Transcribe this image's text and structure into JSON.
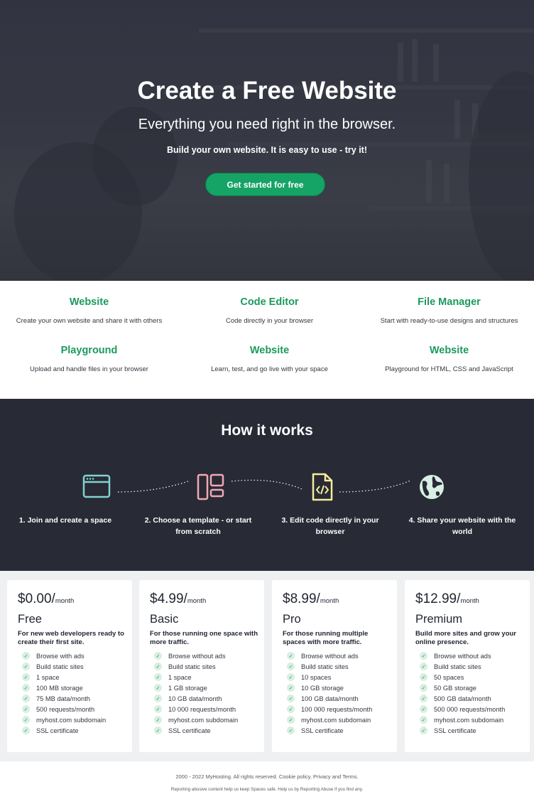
{
  "hero": {
    "title": "Create a Free Website",
    "subtitle": "Everything you need right in the browser.",
    "tagline": "Build your own website. It is easy to use - try it!",
    "cta": "Get started for free"
  },
  "features": [
    {
      "title": "Website",
      "description": "Create your own website and share it with others"
    },
    {
      "title": "Code Editor",
      "description": "Code directly in your browser"
    },
    {
      "title": "File Manager",
      "description": "Start with ready-to-use designs and structures"
    },
    {
      "title": "Playground",
      "description": "Upload and handle files in your browser"
    },
    {
      "title": "Website",
      "description": "Learn, test, and go live with your space"
    },
    {
      "title": "Website",
      "description": "Playground for HTML, CSS and JavaScript"
    }
  ],
  "how_it_works": {
    "title": "How it works",
    "steps": [
      {
        "label": "1. Join and create a space",
        "icon": "browser-window-icon",
        "color": "#7fd3d0"
      },
      {
        "label": "2. Choose a template - or start from scratch",
        "icon": "template-layout-icon",
        "color": "#f2a7b4"
      },
      {
        "label": "3. Edit code directly in your browser",
        "icon": "code-file-icon",
        "color": "#f7ec9a"
      },
      {
        "label": "4. Share your website with the world",
        "icon": "globe-icon",
        "color": "#d9efe6"
      }
    ]
  },
  "pricing": [
    {
      "price": "$0.00/",
      "period": "month",
      "name": "Free",
      "description": "For new web developers ready to create their first site.",
      "features": [
        "Browse with ads",
        "Build static sites",
        "1 space",
        "100 MB storage",
        "75 MB data/month",
        "500 requests/month",
        "myhost.com subdomain",
        "SSL certificate"
      ]
    },
    {
      "price": "$4.99/",
      "period": "month",
      "name": "Basic",
      "description": "For those running one space with more traffic.",
      "features": [
        "Browse without ads",
        "Build static sites",
        "1 space",
        "1 GB storage",
        "10 GB data/month",
        "10 000 requests/month",
        "myhost.com subdomain",
        "SSL certificate"
      ]
    },
    {
      "price": "$8.99/",
      "period": "month",
      "name": "Pro",
      "description": "For those running multiple spaces with more traffic.",
      "features": [
        "Browse without ads",
        "Build static sites",
        "10 spaces",
        "10 GB storage",
        "100 GB data/month",
        "100 000 requests/month",
        "myhost.com subdomain",
        "SSL certificate"
      ]
    },
    {
      "price": "$12.99/",
      "period": "month",
      "name": "Premium",
      "description": "Build more sites and grow your online presence.",
      "features": [
        "Browse without ads",
        "Build static sites",
        "50 spaces",
        "50 GB storage",
        "500 GB data/month",
        "500 000 requests/month",
        "myhost.com subdomain",
        "SSL certificate"
      ]
    }
  ],
  "footer": {
    "copyright": "2000 - 2022 MyHosting. All rights reserved. Cookie policy, Privacy and Terms.",
    "note": "Reporting abusive content help us keep Spaces safe. Help us by Reporting Abuse if you find any."
  },
  "colors": {
    "accent_green": "#16a366",
    "feature_title_green": "#1b9a5e",
    "dark_section": "#282a35",
    "pricing_bg": "#eef0f2"
  }
}
